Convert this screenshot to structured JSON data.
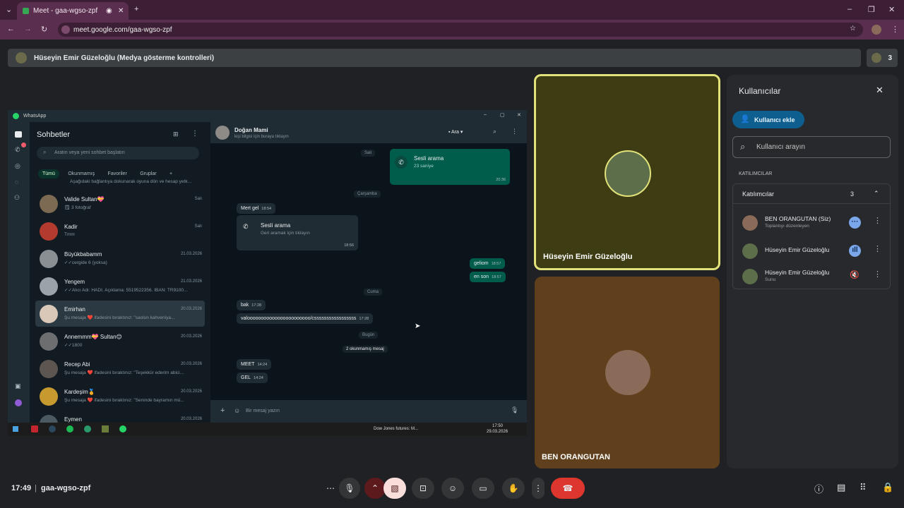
{
  "browser": {
    "tab_title": "Meet - gaa-wgso-zpf",
    "url": "meet.google.com/gaa-wgso-zpf"
  },
  "presentation_bar": {
    "title": "Hüseyin Emir Güzeloğlu (Medya gösterme kontrolleri)",
    "participant_count": "3"
  },
  "whatsapp": {
    "app_title": "WhatsApp",
    "list_title": "Sohbetler",
    "search_placeholder": "Aratın veya yeni sohbet başlatın",
    "filters": [
      "Tümü",
      "Okunmamış",
      "Favoriler",
      "Gruplar",
      "+"
    ],
    "top_notice": "Aşağıdaki bağlantıya dokunarak oyuna dön ve hesap yetk...",
    "chats": [
      {
        "name": "Valide Sultan💝",
        "preview": "🗒 3 fotoğraf",
        "date": "Salı"
      },
      {
        "name": "Kadir",
        "preview": "Tmm",
        "date": "Salı"
      },
      {
        "name": "Büyükbabamm",
        "preview": "✓✓cergide 6 (yoksa)",
        "date": "21.03.2026"
      },
      {
        "name": "Yengem",
        "preview": "✓✓Alıcı Adı: HADI. Açıklama: 5519522356. IBAN: TR9100...",
        "date": "21.03.2026"
      },
      {
        "name": "Emirhan",
        "preview": "Şu mesaja ❤️ ifadesini bıraktınız: \"saolun kahveniya...",
        "date": "20.03.2026"
      },
      {
        "name": "Annemmm💝 Sultan😊",
        "preview": "✓✓1800",
        "date": "20.03.2026"
      },
      {
        "name": "Recep Abi",
        "preview": "Şu mesaja ❤️ ifadesini bıraktınız: \"Teşekkür ederim abici...",
        "date": "20.03.2026"
      },
      {
        "name": "Kardeşim🏅",
        "preview": "Şu mesaja ❤️ ifadesini bıraktınız: \"Seninde bayramın mü...",
        "date": "20.03.2026"
      },
      {
        "name": "Eymen",
        "preview": "",
        "date": "20.03.2026"
      }
    ],
    "conversation": {
      "contact_name": "Doğan Mami",
      "contact_sub": "kişi bilgisi için buraya tıklayın",
      "call_label": "Ara",
      "day_sali": "Salı",
      "call_out_title": "Sesli arama",
      "call_out_sub": "23 saniye",
      "call_out_time": "20:36",
      "day_carsamba": "Çarşamba",
      "msg_mert": "Mert gel",
      "msg_mert_time": "18:54",
      "call_in_title": "Sesli arama",
      "call_in_sub": "Geri aramak için tıklayın",
      "call_in_time": "18:56",
      "msg_geliom": "geliom",
      "msg_geliom_time": "18:57",
      "msg_enson": "en son",
      "msg_enson_time": "18:57",
      "day_cuma": "Cuma",
      "msg_bak": "bak",
      "msg_bak_time": "17:28",
      "msg_valo": "valooooooooooooooooooooooo/csssssssssssssssss",
      "msg_valo_time": "17:28",
      "day_bugun": "Bugün",
      "unread": "2 okunmamış mesaj",
      "msg_meet": "MEET",
      "msg_meet_time": "14:24",
      "msg_gel": "GEL",
      "msg_gel_time": "14:24",
      "composer_placeholder": "Bir mesaj yazın"
    },
    "taskbar": {
      "news": "Dow Jones futures: M...",
      "time": "17:50",
      "date": "29.03.2026"
    }
  },
  "tiles": [
    {
      "name": "Hüseyin Emir Güzeloğlu"
    },
    {
      "name": "BEN ORANGUTAN"
    }
  ],
  "people_panel": {
    "title": "Kullanıcılar",
    "add_button": "Kullanıcı ekle",
    "search_placeholder": "Kullanıcı arayın",
    "section_label": "KATILIMCILAR",
    "group_title": "Katılımcılar",
    "group_count": "3",
    "people": [
      {
        "name": "BEN ORANGUTAN (Siz)",
        "sub": "Toplantıyı düzenleyen"
      },
      {
        "name": "Hüseyin Emir Güzeloğlu",
        "sub": ""
      },
      {
        "name": "Hüseyin Emir Güzeloğlu",
        "sub": "Sunu"
      }
    ]
  },
  "bottom_bar": {
    "time": "17:49",
    "meeting_code": "gaa-wgso-zpf"
  },
  "colors": {
    "accent": "#0e5e8f",
    "end_call": "#dc362e",
    "speaker_border": "#e2e27a",
    "whatsapp_green": "#005c4b"
  }
}
